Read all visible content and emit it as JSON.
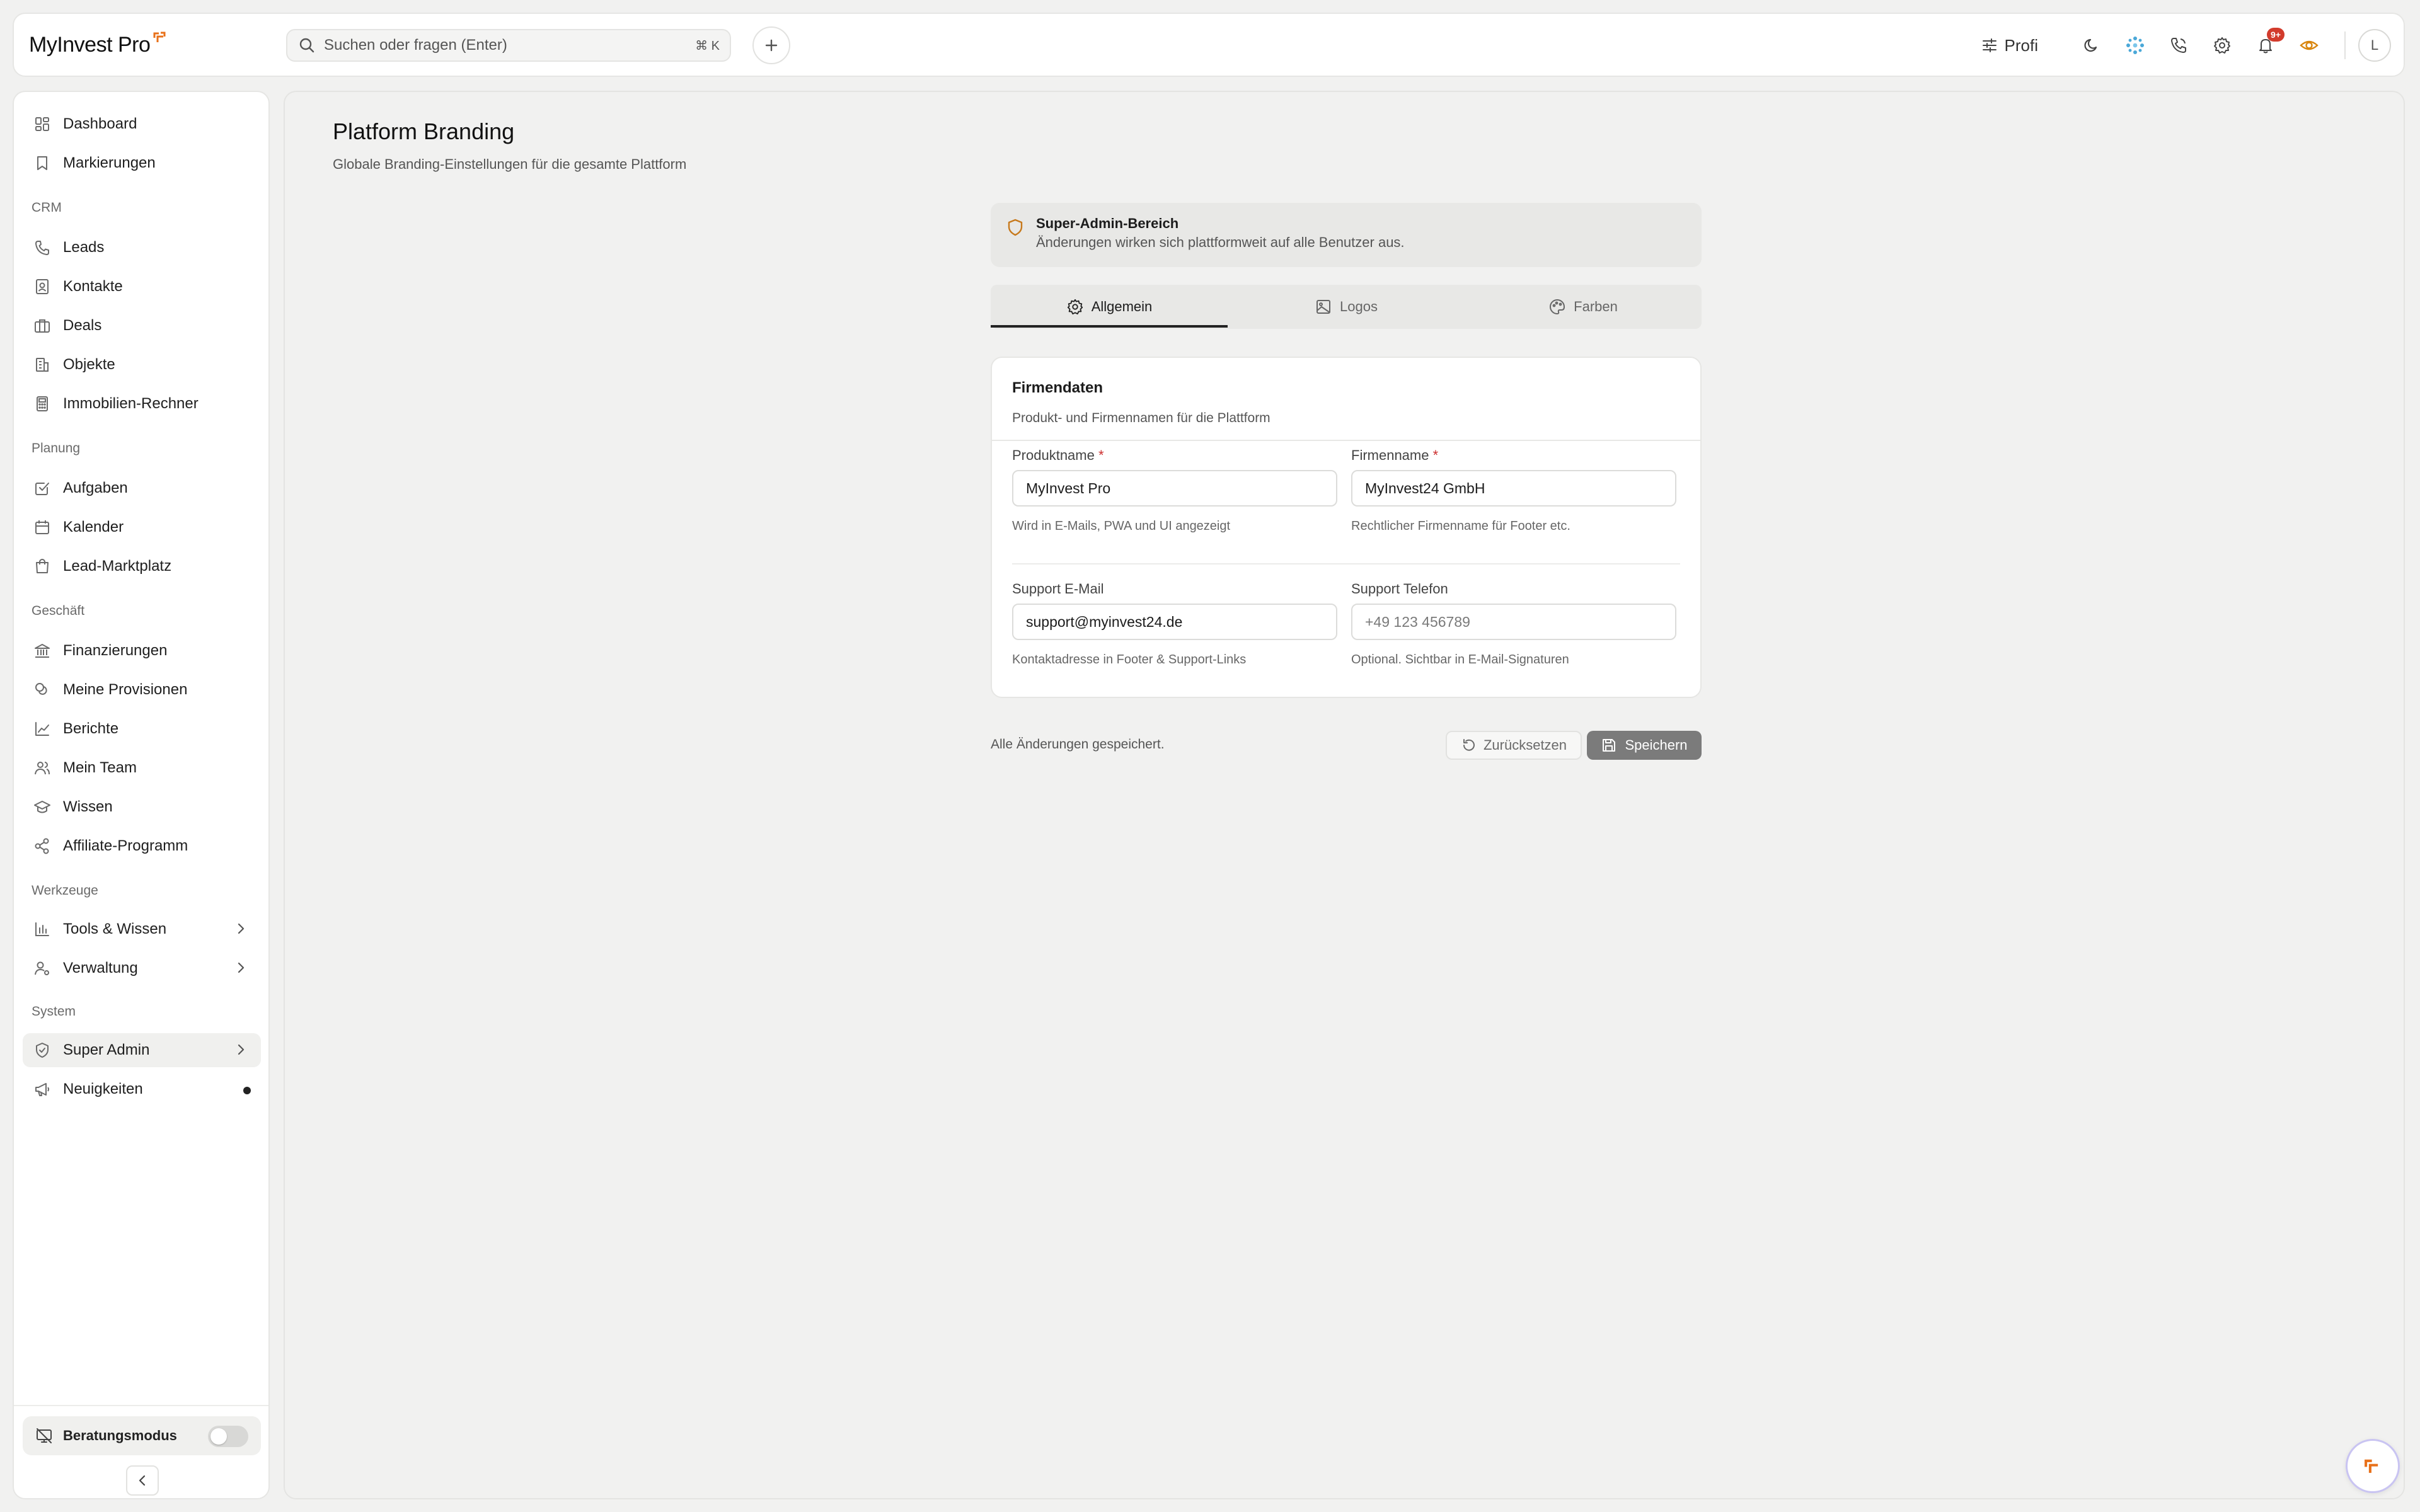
{
  "app": {
    "logo_text": "MyInvest Pro",
    "search_placeholder": "Suchen oder fragen (Enter)",
    "search_shortcut": "⌘ K",
    "profile_mode_label": "Profi",
    "notification_badge": "9+",
    "avatar_initial": "L",
    "accent_color": "#e8711a"
  },
  "sidebar": {
    "items_top": [
      {
        "label": "Dashboard",
        "icon": "dashboard-icon"
      },
      {
        "label": "Markierungen",
        "icon": "bookmark-icon"
      }
    ],
    "sections": [
      {
        "title": "CRM",
        "items": [
          {
            "label": "Leads",
            "icon": "phone-icon"
          },
          {
            "label": "Kontakte",
            "icon": "contact-icon"
          },
          {
            "label": "Deals",
            "icon": "briefcase-icon"
          },
          {
            "label": "Objekte",
            "icon": "building-icon"
          },
          {
            "label": "Immobilien-Rechner",
            "icon": "calculator-icon"
          }
        ]
      },
      {
        "title": "Planung",
        "items": [
          {
            "label": "Aufgaben",
            "icon": "checkbox-icon"
          },
          {
            "label": "Kalender",
            "icon": "calendar-icon"
          },
          {
            "label": "Lead-Marktplatz",
            "icon": "shopping-bag-icon"
          }
        ]
      },
      {
        "title": "Geschäft",
        "items": [
          {
            "label": "Finanzierungen",
            "icon": "bank-icon"
          },
          {
            "label": "Meine Provisionen",
            "icon": "coins-icon"
          },
          {
            "label": "Berichte",
            "icon": "line-chart-icon"
          },
          {
            "label": "Mein Team",
            "icon": "users-icon"
          },
          {
            "label": "Wissen",
            "icon": "graduation-cap-icon"
          },
          {
            "label": "Affiliate-Programm",
            "icon": "share-icon"
          }
        ]
      },
      {
        "title": "Werkzeuge",
        "items": [
          {
            "label": "Tools & Wissen",
            "icon": "bar-chart-icon"
          },
          {
            "label": "Verwaltung",
            "icon": "user-cog-icon"
          }
        ]
      },
      {
        "title": "System",
        "items": [
          {
            "label": "Super Admin",
            "icon": "shield-icon"
          },
          {
            "label": "Neuigkeiten",
            "icon": "megaphone-icon"
          }
        ]
      }
    ],
    "consult_mode_label": "Beratungsmodus",
    "consult_mode_on": false
  },
  "page": {
    "title": "Platform Branding",
    "subtitle": "Globale Branding-Einstellungen für die gesamte Plattform",
    "notice": {
      "title": "Super-Admin-Bereich",
      "text": "Änderungen wirken sich plattformweit auf alle Benutzer aus."
    },
    "tabs": [
      {
        "label": "Allgemein",
        "active": true
      },
      {
        "label": "Logos",
        "active": false
      },
      {
        "label": "Farben",
        "active": false
      }
    ],
    "card": {
      "title": "Firmendaten",
      "subtitle": "Produkt- und Firmennamen für die Plattform",
      "fields": {
        "product_name": {
          "label": "Produktname",
          "required_mark": "*",
          "value": "MyInvest Pro",
          "help": "Wird in E-Mails, PWA und UI angezeigt"
        },
        "company_name": {
          "label": "Firmenname",
          "required_mark": "*",
          "value": "MyInvest24 GmbH",
          "help": "Rechtlicher Firmenname für Footer etc."
        },
        "support_email": {
          "label": "Support E-Mail",
          "value": "support@myinvest24.de",
          "help": "Kontaktadresse in Footer & Support-Links"
        },
        "support_phone": {
          "label": "Support Telefon",
          "placeholder": "+49 123 456789",
          "help": "Optional. Sichtbar in E-Mail-Signaturen"
        }
      }
    },
    "status_text": "Alle Änderungen gespeichert.",
    "reset_label": "Zurücksetzen",
    "save_label": "Speichern"
  }
}
